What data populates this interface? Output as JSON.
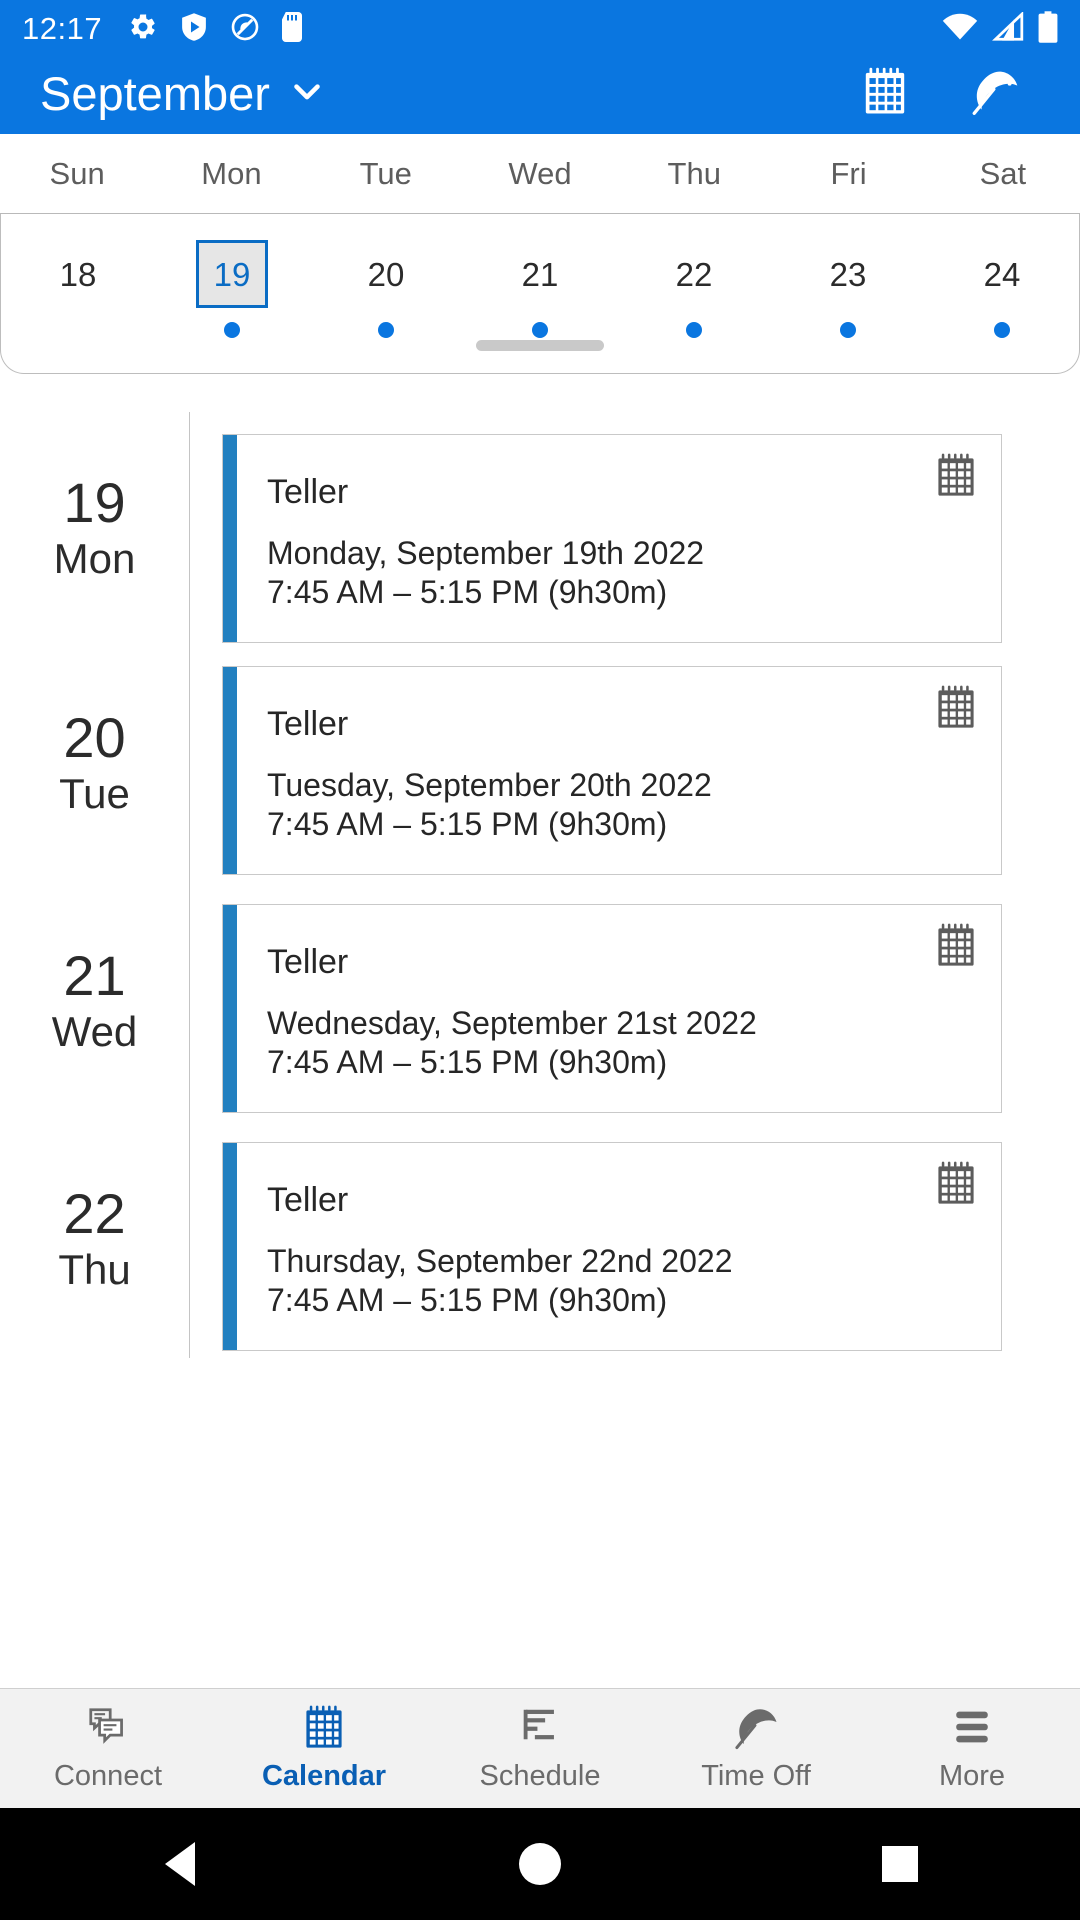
{
  "status_bar": {
    "time": "12:17",
    "left_icons": [
      "gear-icon",
      "shield-play-icon",
      "do-not-disturb-icon",
      "sd-card-icon"
    ],
    "right_icons": [
      "wifi-icon",
      "cell-signal-icon",
      "battery-icon"
    ]
  },
  "app_bar": {
    "title": "September",
    "dropdown_icon": "chevron-down-icon",
    "actions": [
      {
        "name": "calendar-view-button",
        "icon": "calendar-icon"
      },
      {
        "name": "time-off-button",
        "icon": "beach-umbrella-icon"
      }
    ],
    "background_color": "#0a76e0"
  },
  "weekday_header": {
    "labels": [
      "Sun",
      "Mon",
      "Tue",
      "Wed",
      "Thu",
      "Fri",
      "Sat"
    ]
  },
  "week_strip": {
    "days": [
      {
        "num": "18",
        "selected": false,
        "has_event": false
      },
      {
        "num": "19",
        "selected": true,
        "has_event": true
      },
      {
        "num": "20",
        "selected": false,
        "has_event": true
      },
      {
        "num": "21",
        "selected": false,
        "has_event": true
      },
      {
        "num": "22",
        "selected": false,
        "has_event": true
      },
      {
        "num": "23",
        "selected": false,
        "has_event": true
      },
      {
        "num": "24",
        "selected": false,
        "has_event": true
      }
    ],
    "selected_accent_color": "#0a6cc4",
    "dot_color": "#0a76e0",
    "drag_handle": "drag-handle"
  },
  "agenda": {
    "rows": [
      {
        "day_num": "19",
        "day_name": "Mon",
        "event": {
          "title": "Teller",
          "date": "Monday, September 19th 2022",
          "time": "7:45 AM – 5:15 PM (9h30m)",
          "icon": "calendar-icon",
          "accent_color": "#2280c0"
        }
      },
      {
        "day_num": "20",
        "day_name": "Tue",
        "event": {
          "title": "Teller",
          "date": "Tuesday, September 20th 2022",
          "time": "7:45 AM – 5:15 PM (9h30m)",
          "icon": "calendar-icon",
          "accent_color": "#2280c0"
        }
      },
      {
        "day_num": "21",
        "day_name": "Wed",
        "event": {
          "title": "Teller",
          "date": "Wednesday, September 21st 2022",
          "time": "7:45 AM – 5:15 PM (9h30m)",
          "icon": "calendar-icon",
          "accent_color": "#2280c0"
        }
      },
      {
        "day_num": "22",
        "day_name": "Thu",
        "event": {
          "title": "Teller",
          "date": "Thursday, September 22nd 2022",
          "time": "7:45 AM – 5:15 PM (9h30m)",
          "icon": "calendar-icon",
          "accent_color": "#2280c0"
        }
      }
    ]
  },
  "bottom_nav": {
    "active_color": "#0a5fb4",
    "inactive_color": "#6b6b6b",
    "items": [
      {
        "label": "Connect",
        "icon": "chat-bubbles-icon",
        "active": false
      },
      {
        "label": "Calendar",
        "icon": "calendar-icon",
        "active": true
      },
      {
        "label": "Schedule",
        "icon": "list-lines-icon",
        "active": false
      },
      {
        "label": "Time Off",
        "icon": "beach-umbrella-icon",
        "active": false
      },
      {
        "label": "More",
        "icon": "hamburger-icon",
        "active": false
      }
    ]
  },
  "android_nav": {
    "back": "back-triangle-icon",
    "home": "home-circle-icon",
    "recents": "recents-square-icon"
  }
}
